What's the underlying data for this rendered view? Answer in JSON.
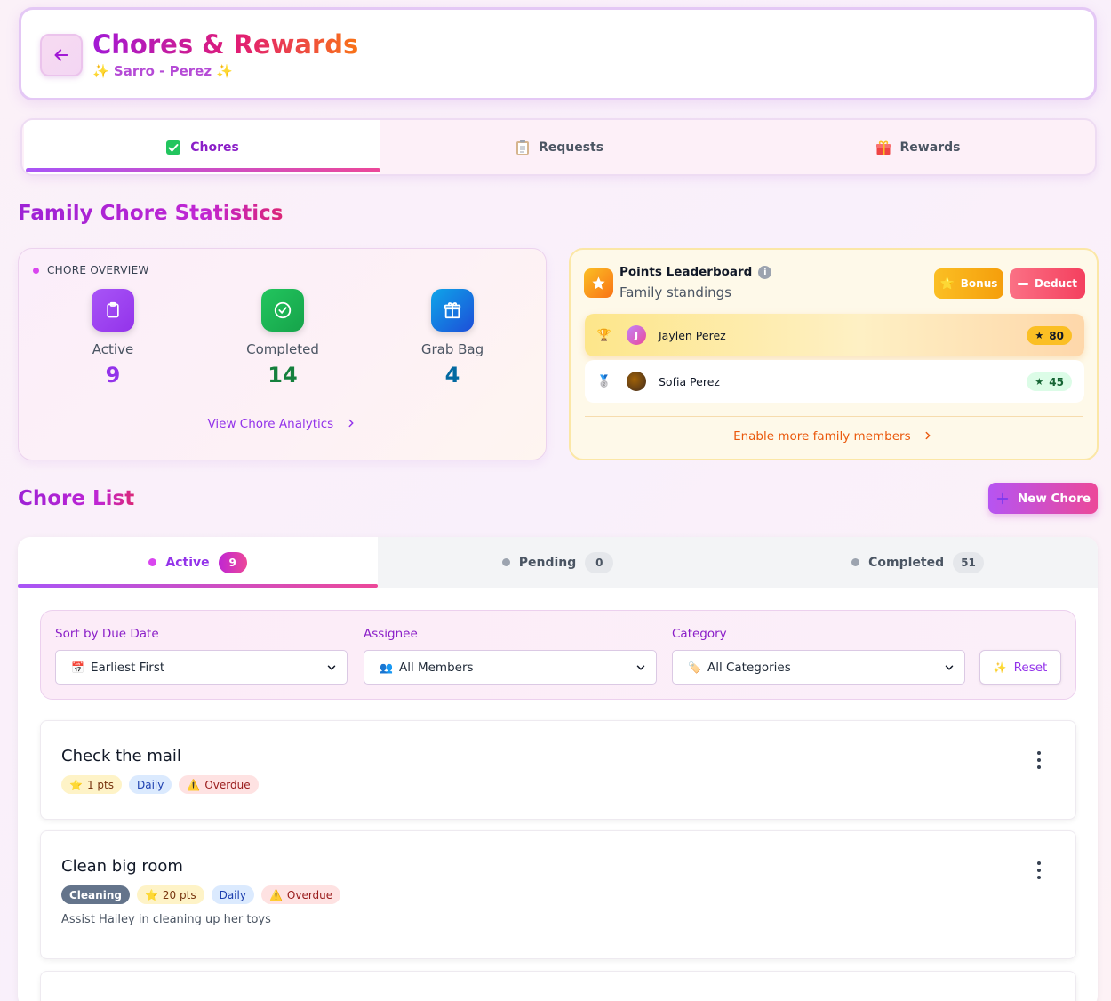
{
  "header": {
    "title": "Chores & Rewards",
    "subtitle": "✨ Sarro - Perez ✨"
  },
  "main_tabs": [
    {
      "label": "Chores",
      "icon": "check-box-icon",
      "active": true
    },
    {
      "label": "Requests",
      "icon": "clipboard-icon",
      "active": false
    },
    {
      "label": "Rewards",
      "icon": "gift-icon",
      "active": false
    }
  ],
  "stats_section": {
    "title": "Family Chore Statistics"
  },
  "overview": {
    "label": "CHORE OVERVIEW",
    "stats": [
      {
        "label": "Active",
        "value": "9",
        "color": "#9333ea",
        "icon": "clipboard-icon"
      },
      {
        "label": "Completed",
        "value": "14",
        "color": "#15803d",
        "icon": "check-circle-icon"
      },
      {
        "label": "Grab Bag",
        "value": "4",
        "color": "#0369a1",
        "icon": "gift-icon"
      }
    ],
    "link": "View Chore Analytics"
  },
  "leaderboard": {
    "title": "Points Leaderboard",
    "info": "i",
    "subtitle": "Family standings",
    "bonus_label": "Bonus",
    "deduct_label": "Deduct",
    "entries": [
      {
        "rank_icon": "trophy-icon",
        "initial": "J",
        "name": "Jaylen Perez",
        "points": "80"
      },
      {
        "rank_icon": "second-medal-icon",
        "initial": "",
        "name": "Sofia Perez",
        "points": "45"
      }
    ],
    "link": "Enable more family members"
  },
  "chore_list": {
    "title": "Chore List",
    "new_button": "New Chore"
  },
  "sub_tabs": [
    {
      "label": "Active",
      "count": "9",
      "active": true
    },
    {
      "label": "Pending",
      "count": "0",
      "active": false
    },
    {
      "label": "Completed",
      "count": "51",
      "active": false
    }
  ],
  "filters": {
    "sort_label": "Sort by Due Date",
    "sort_value": "Earliest First",
    "assignee_label": "Assignee",
    "assignee_value": "All Members",
    "category_label": "Category",
    "category_value": "All Categories",
    "reset_label": "Reset"
  },
  "chores": [
    {
      "title": "Check the mail",
      "category": "",
      "points": "1 pts",
      "frequency": "Daily",
      "status": "Overdue",
      "description": ""
    },
    {
      "title": "Clean big room",
      "category": "Cleaning",
      "points": "20 pts",
      "frequency": "Daily",
      "status": "Overdue",
      "description": "Assist Hailey in cleaning up her toys"
    }
  ],
  "colors": {
    "accent_purple": "#9333ea",
    "accent_pink": "#ec4899",
    "leaderboard_orange": "#ea580c"
  }
}
